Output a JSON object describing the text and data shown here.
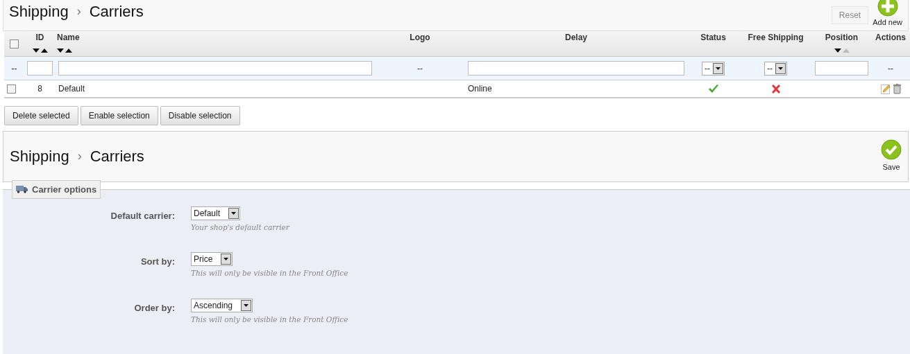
{
  "top_bar": {
    "breadcrumb": [
      "Shipping",
      "Carriers"
    ],
    "separator": "›",
    "filter_buttons": [
      "Reset"
    ],
    "add_new": "Add new"
  },
  "table": {
    "columns": [
      {
        "kind": "checkbox",
        "checked": false
      },
      {
        "label": "ID",
        "sortable": true,
        "ascending_enabled": true
      },
      {
        "label": "Name",
        "sortable": true,
        "ascending_enabled": true
      },
      {
        "label": "Logo",
        "sortable": false
      },
      {
        "label": "Delay",
        "sortable": false
      },
      {
        "label": "Status",
        "sortable": false
      },
      {
        "label": "Free Shipping",
        "sortable": false
      },
      {
        "label": "Position",
        "sortable": true,
        "ascending_enabled": false
      },
      {
        "label": "Actions",
        "sortable": false
      }
    ],
    "filters": [
      {
        "kind": "text",
        "text": "--"
      },
      {
        "kind": "input"
      },
      {
        "kind": "input"
      },
      {
        "kind": "text",
        "text": "--"
      },
      {
        "kind": "input"
      },
      {
        "kind": "select",
        "value": "--"
      },
      {
        "kind": "select",
        "value": "--"
      },
      {
        "kind": "input"
      },
      {
        "kind": "text",
        "text": "--"
      }
    ],
    "rows": [
      {
        "checked": false,
        "id": "8",
        "name": "Default",
        "delay": "Online",
        "status": true,
        "free_shipping": false
      }
    ]
  },
  "bulk_buttons": [
    "Delete selected",
    "Enable selection",
    "Disable selection"
  ],
  "toolbar": {
    "breadcrumb": [
      "Shipping",
      "Carriers"
    ],
    "separator": "›",
    "save": "Save"
  },
  "options": {
    "legend": "Carrier options",
    "fields": [
      {
        "label": "Default carrier:",
        "value": "Default",
        "hint": "Your shop's default carrier"
      },
      {
        "label": "Sort by:",
        "value": "Price",
        "hint": "This will only be visible in the Front Office"
      },
      {
        "label": "Order by:",
        "value": "Ascending",
        "hint": "This will only be visible in the Front Office"
      }
    ]
  }
}
